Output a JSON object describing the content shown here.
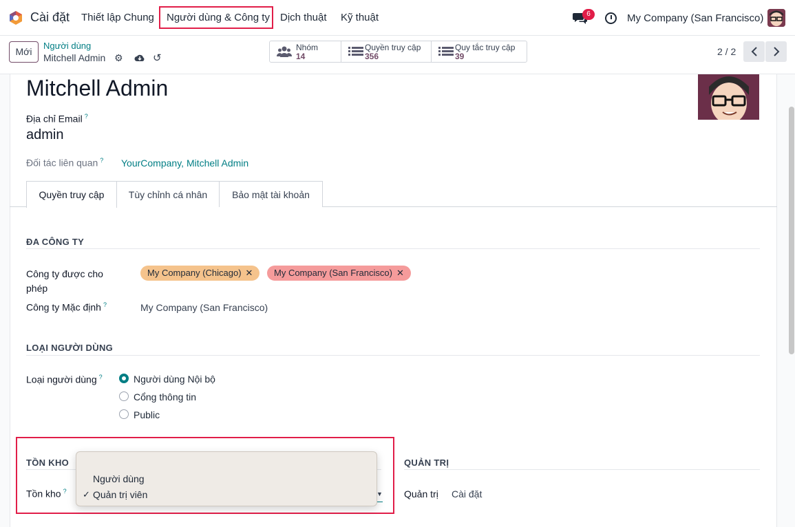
{
  "navbar": {
    "app_title": "Cài đặt",
    "menu": [
      "Thiết lập Chung",
      "Người dùng & Công ty",
      "Dịch thuật",
      "Kỹ thuật"
    ],
    "chat_badge": "6",
    "company": "My Company (San Francisco)"
  },
  "control": {
    "new_button": "Mới",
    "breadcrumb_parent": "Người dùng",
    "breadcrumb_current": "Mitchell Admin",
    "smart_buttons": [
      {
        "label": "Nhóm",
        "value": "14",
        "icon": "users-icon"
      },
      {
        "label": "Quyền truy cập",
        "value": "356",
        "icon": "list-icon"
      },
      {
        "label": "Quy tắc truy cập",
        "value": "39",
        "icon": "list-icon"
      }
    ],
    "pager": "2 / 2"
  },
  "form": {
    "name": "Mitchell Admin",
    "email_label": "Địa chỉ Email",
    "email_value": "admin",
    "partner_label": "Đối tác liên quan",
    "partner_value": "YourCompany, Mitchell Admin",
    "tabs": [
      "Quyền truy cập",
      "Tùy chỉnh cá nhân",
      "Bảo mật tài khoản"
    ],
    "multi_company": {
      "title": "ĐA CÔNG TY",
      "allowed_label": "Công ty được cho phép",
      "allowed_tags": [
        {
          "name": "My Company (Chicago)",
          "color": "#f5c38c"
        },
        {
          "name": "My Company (San Francisco)",
          "color": "#f59b9b"
        }
      ],
      "default_label": "Công ty Mặc định",
      "default_value": "My Company (San Francisco)"
    },
    "user_type": {
      "title": "LOẠI NGƯỜI DÙNG",
      "label": "Loại người dùng",
      "options": [
        "Người dùng Nội bộ",
        "Cổng thông tin",
        "Public"
      ],
      "selected": "Người dùng Nội bộ"
    },
    "inventory": {
      "title": "TỒN KHO",
      "label": "Tồn kho",
      "dropdown_options": [
        "Người dùng",
        "Quản trị viên"
      ],
      "selected": "Quản trị viên"
    },
    "admin": {
      "title": "QUẢN TRỊ",
      "label": "Quản trị",
      "value": "Cài đặt"
    }
  },
  "colors": {
    "accent": "#017e84",
    "brand": "#714b67",
    "highlight": "#e11d48"
  }
}
